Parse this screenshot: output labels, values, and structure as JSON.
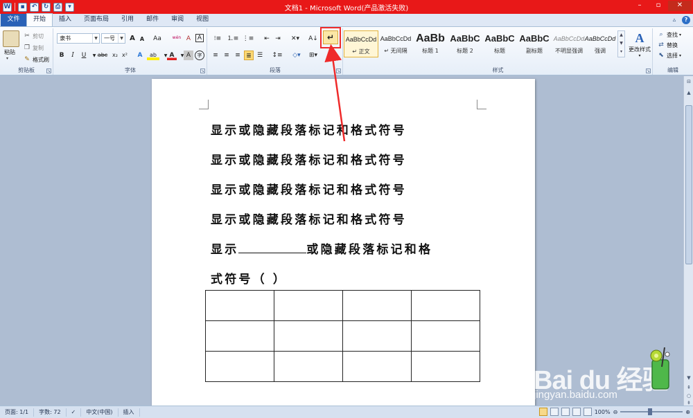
{
  "window": {
    "title": "文档1 - Microsoft Word(产品激活失败)",
    "qat_icons": [
      "word-app-icon",
      "save-icon",
      "undo-icon",
      "redo-icon",
      "print-preview-icon"
    ]
  },
  "tabs": [
    {
      "label": "文件"
    },
    {
      "label": "开始"
    },
    {
      "label": "插入"
    },
    {
      "label": "页面布局"
    },
    {
      "label": "引用"
    },
    {
      "label": "邮件"
    },
    {
      "label": "审阅"
    },
    {
      "label": "视图"
    }
  ],
  "ribbon": {
    "clipboard": {
      "label": "剪贴板",
      "paste": "粘贴",
      "cut": "剪切",
      "copy": "复制",
      "format_painter": "格式刷"
    },
    "font": {
      "label": "字体",
      "font_name": "隶书",
      "font_size": "一号",
      "grow": "A",
      "shrink": "A",
      "change_case": "Aa",
      "clear_format": "A",
      "phonetic": "wén",
      "char_border": "A",
      "bold": "B",
      "italic": "I",
      "underline": "U",
      "strike": "abc",
      "subscript": "x₂",
      "superscript": "x²",
      "text_effect": "A",
      "highlight": "ab",
      "font_color": "A",
      "char_shading": "A",
      "enclose_char": "字"
    },
    "paragraph": {
      "label": "段落",
      "show_hide_glyph": "↵"
    },
    "styles": {
      "label": "样式",
      "items": [
        {
          "sample": "AaBbCcDd",
          "name": "↵ 正文"
        },
        {
          "sample": "AaBbCcDd",
          "name": "↵ 无间隔"
        },
        {
          "sample": "AaBb",
          "name": "标题 1"
        },
        {
          "sample": "AaBbC",
          "name": "标题 2"
        },
        {
          "sample": "AaBbC",
          "name": "标题"
        },
        {
          "sample": "AaBbC",
          "name": "副标题"
        },
        {
          "sample": "AaBbCcDd",
          "name": "不明显强调"
        },
        {
          "sample": "AaBbCcDd",
          "name": "强调"
        }
      ],
      "change_styles": "更改样式"
    },
    "editing": {
      "label": "编辑",
      "find": "查找",
      "replace": "替换",
      "select": "选择"
    }
  },
  "document": {
    "lines": [
      "显示或隐藏段落标记和格式符号",
      "显示或隐藏段落标记和格式符号",
      "显示或隐藏段落标记和格式符号",
      "显示或隐藏段落标记和格式符号"
    ],
    "line5_start": "显示",
    "line5_end": "或隐藏段落标记和格",
    "line6": "式符号（     ）",
    "table": {
      "rows": 3,
      "cols": 4
    }
  },
  "status_bar": {
    "page": "页面: 1/1",
    "words": "字数: 72",
    "language": "中文(中国)",
    "mode": "插入",
    "zoom": "100%"
  },
  "watermark": {
    "text": "Bai du 经验",
    "url": "jingyan.baidu.com"
  },
  "colors": {
    "title_bar": "#e81818",
    "file_tab": "#2a62b7",
    "annotation": "#ef2a2a"
  }
}
